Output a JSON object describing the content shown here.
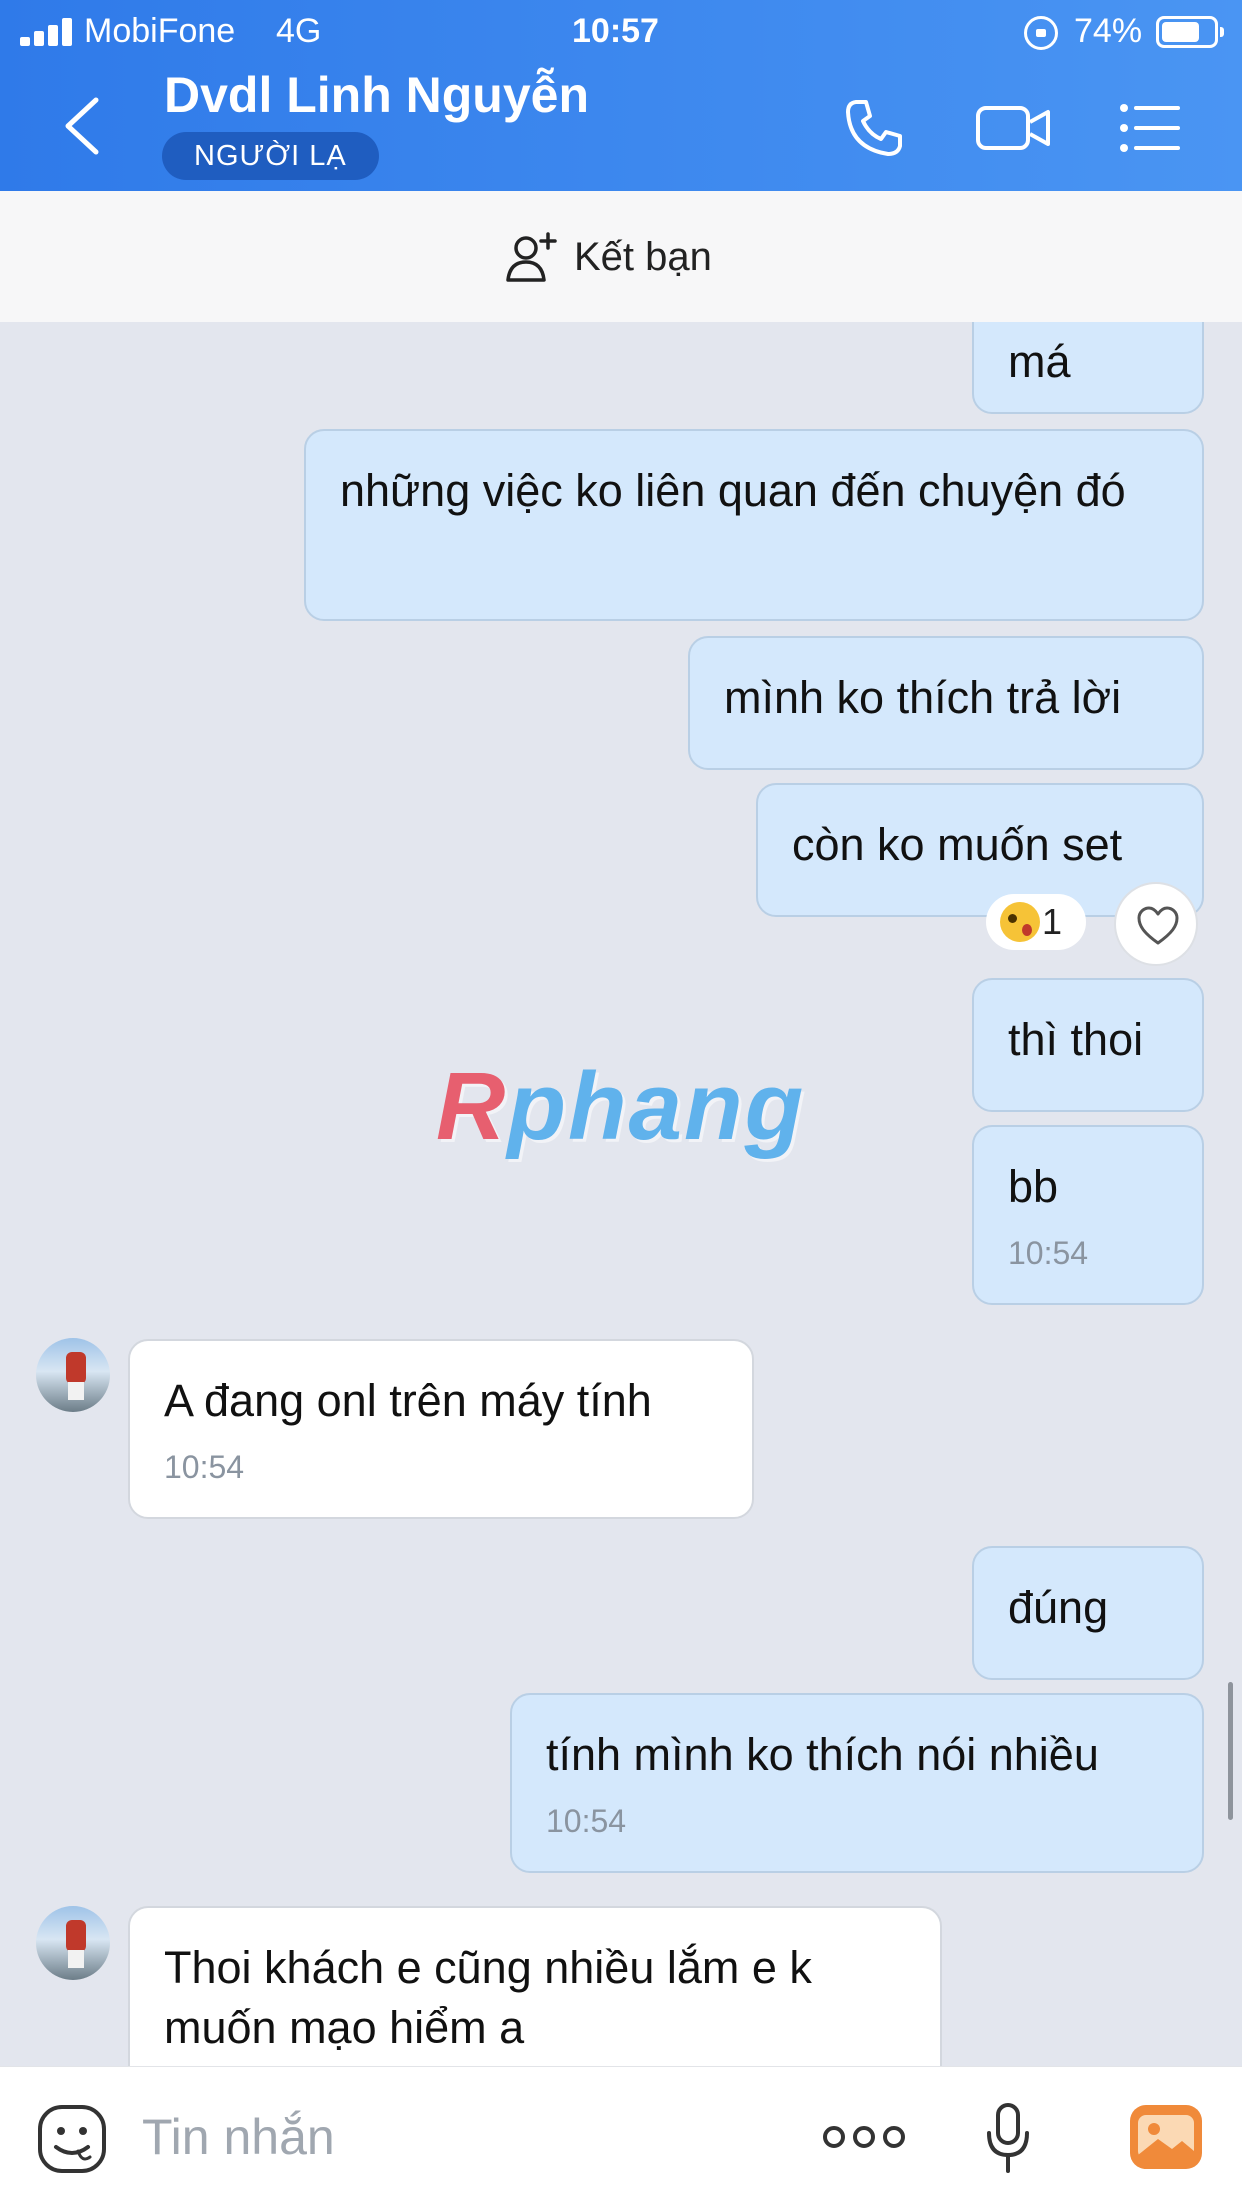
{
  "status_bar": {
    "carrier": "MobiFone",
    "network": "4G",
    "time": "10:57",
    "battery": "74%",
    "battery_level": 0.74
  },
  "header": {
    "contact_name": "Dvdl Linh Nguyễn",
    "badge": "NGƯỜI LẠ"
  },
  "add_friend": {
    "label": "Kết bạn"
  },
  "messages": [
    {
      "text": "má",
      "time": ""
    },
    {
      "text": "những việc ko liên quan đến chuyện đó",
      "time": ""
    },
    {
      "text": "mình ko thích trả lời",
      "time": ""
    },
    {
      "text": "còn ko muốn set",
      "time": ""
    },
    {
      "text": "thì thoi",
      "time": ""
    },
    {
      "text": "bb",
      "time": "10:54"
    },
    {
      "text": "A đang onl trên máy tính",
      "time": "10:54"
    },
    {
      "text": "đúng",
      "time": ""
    },
    {
      "text": "tính mình ko thích nói nhiều",
      "time": "10:54"
    },
    {
      "text": "Thoi khách e cũng nhiều lắm e k muốn mạo hiểm a",
      "time": ""
    }
  ],
  "reaction": {
    "count": "1"
  },
  "watermark": {
    "text": "Rphang"
  },
  "input": {
    "placeholder": "Tin nhắn"
  },
  "colors": {
    "header_start": "#2f7ae9",
    "header_end": "#4a95f3",
    "outgoing_bubble": "#d4e8fc",
    "incoming_bubble": "#ffffff",
    "chat_bg": "#e3e6ee"
  }
}
